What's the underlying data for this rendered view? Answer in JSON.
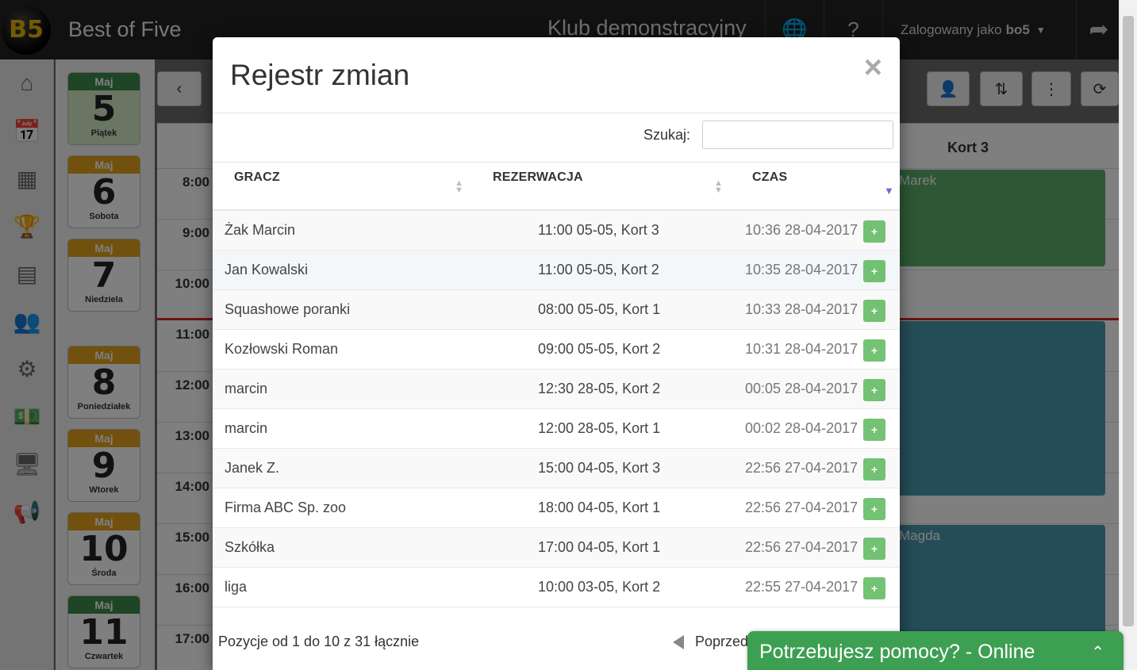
{
  "app": {
    "logo": "B5",
    "title": "Best of Five",
    "club": "Klub demonstracyjny",
    "user_prefix": "Zalogowany jako",
    "user_name": "bo5"
  },
  "days": [
    {
      "month": "Maj",
      "num": "5",
      "name": "Piątek",
      "color": "green",
      "selected": true
    },
    {
      "month": "Maj",
      "num": "6",
      "name": "Sobota",
      "color": "orange"
    },
    {
      "month": "Maj",
      "num": "7",
      "name": "Niedziela",
      "color": "orange"
    },
    {
      "month": "Maj",
      "num": "8",
      "name": "Poniedziałek",
      "color": "orange"
    },
    {
      "month": "Maj",
      "num": "9",
      "name": "Wtorek",
      "color": "orange"
    },
    {
      "month": "Maj",
      "num": "10",
      "name": "Środa",
      "color": "orange"
    },
    {
      "month": "Maj",
      "num": "11",
      "name": "Czwartek",
      "color": "green"
    }
  ],
  "hours": [
    "8:00",
    "9:00",
    "10:00",
    "11:00",
    "12:00",
    "13:00",
    "14:00",
    "15:00",
    "16:00",
    "17:00"
  ],
  "court_header": "Kort 3",
  "reservations": [
    "Marek",
    "",
    "Magda"
  ],
  "modal": {
    "title": "Rejestr zmian",
    "close": "×",
    "search_label": "Szukaj:",
    "search_value": "",
    "columns": {
      "player": "GRACZ",
      "reservation": "REZERWACJA",
      "time": "CZAS"
    },
    "rows": [
      {
        "player": "Żak Marcin",
        "reservation": "11:00 05-05, Kort 3",
        "time": "10:36 28-04-2017"
      },
      {
        "player": "Jan Kowalski",
        "reservation": "11:00 05-05, Kort 2",
        "time": "10:35 28-04-2017"
      },
      {
        "player": "Squashowe poranki",
        "reservation": "08:00 05-05, Kort 1",
        "time": "10:33 28-04-2017"
      },
      {
        "player": "Kozłowski Roman",
        "reservation": "09:00 05-05, Kort 2",
        "time": "10:31 28-04-2017"
      },
      {
        "player": "marcin",
        "reservation": "12:30 28-05, Kort 2",
        "time": "00:05 28-04-2017"
      },
      {
        "player": "marcin",
        "reservation": "12:00 28-05, Kort 1",
        "time": "00:02 28-04-2017"
      },
      {
        "player": "Janek Z.",
        "reservation": "15:00 04-05, Kort 3",
        "time": "22:56 27-04-2017"
      },
      {
        "player": "Firma ABC Sp. zoo",
        "reservation": "18:00 04-05, Kort 1",
        "time": "22:56 27-04-2017"
      },
      {
        "player": "Szkółka",
        "reservation": "17:00 04-05, Kort 1",
        "time": "22:56 27-04-2017"
      },
      {
        "player": "liga",
        "reservation": "10:00 03-05, Kort 2",
        "time": "22:55 27-04-2017"
      }
    ],
    "plus_label": "+",
    "info": "Pozycje od 1 do 10 z 31 łącznie",
    "prev_label": "Poprzed"
  },
  "help_widget": {
    "label": "Potrzebujesz pomocy? - Online",
    "chevron": "⌃"
  },
  "colors": {
    "accent_green": "#5cb85c",
    "topbar": "#222222",
    "month_orange": "#e3a21a",
    "month_green": "#3d8a4b"
  }
}
